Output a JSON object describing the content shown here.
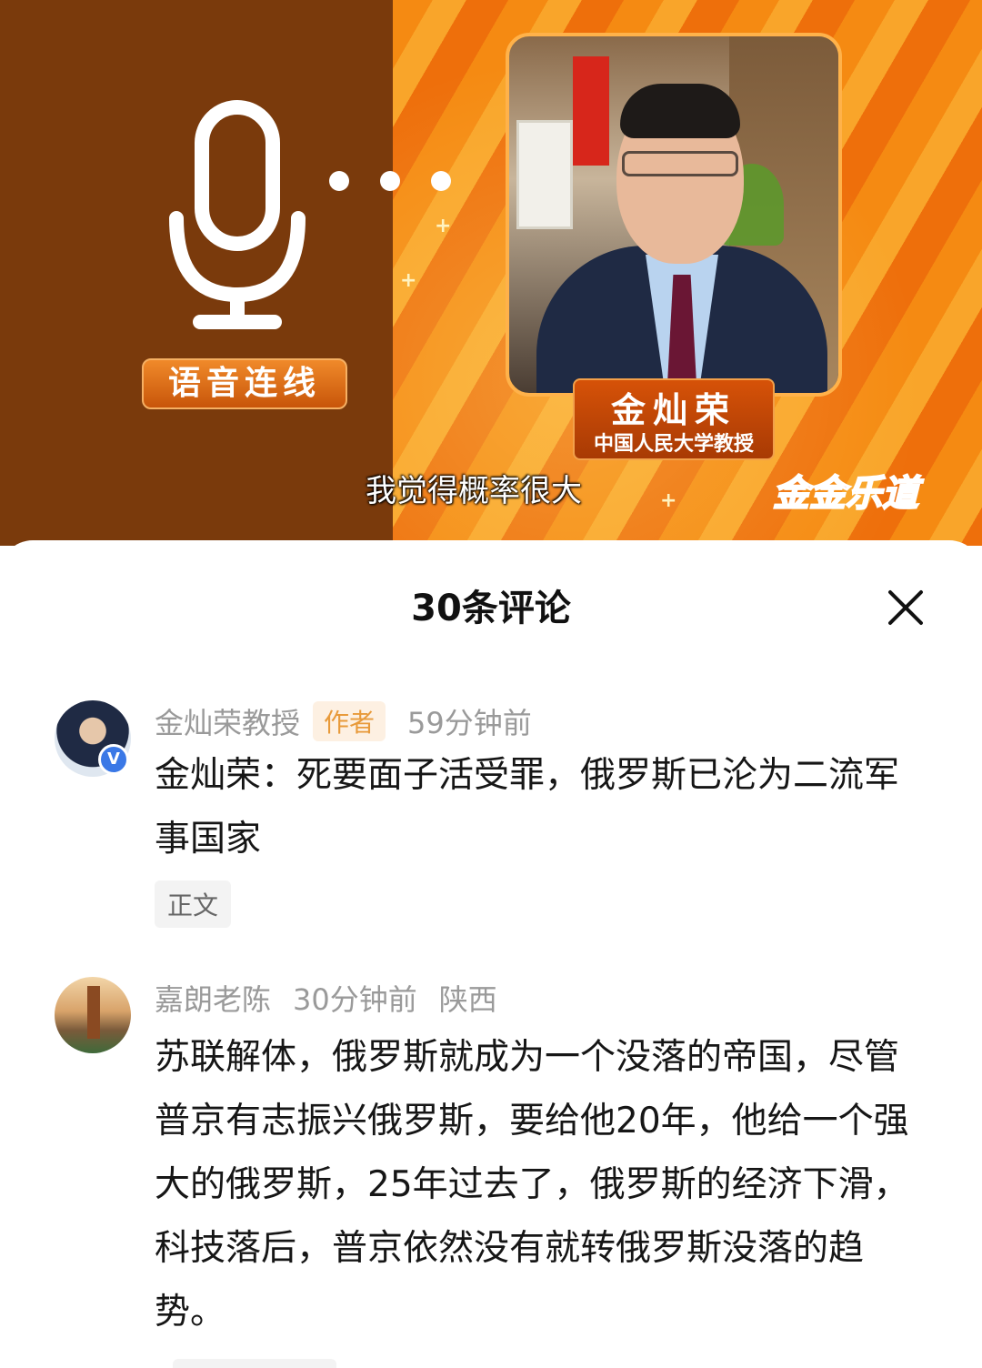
{
  "video": {
    "voice_badge": "语音连线",
    "guest_name": "金灿荣",
    "guest_title": "中国人民大学教授",
    "subtitle": "我觉得概率很大",
    "logo_text": "金金乐道",
    "colors": {
      "left_panel": "#7a3a0c",
      "right_panel": "#f58a12"
    }
  },
  "comments_sheet": {
    "title": "30条评论",
    "close_icon": "close-icon",
    "comments": [
      {
        "username": "金灿荣教授",
        "author_tag": "作者",
        "time": "59分钟前",
        "verified": true,
        "text": "金灿荣：死要面子活受罪，俄罗斯已沦为二流军事国家",
        "chip": "正文"
      },
      {
        "username": "嘉朗老陈",
        "time": "30分钟前",
        "location": "陕西",
        "text": "苏联解体，俄罗斯就成为一个没落的帝国，尽管普京有志振兴俄罗斯，要给他20年，他给一个强大的俄罗斯，25年过去了，俄罗斯的经济下滑，科技落后，普京依然没有就转俄罗斯没落的趋势。"
      }
    ]
  }
}
